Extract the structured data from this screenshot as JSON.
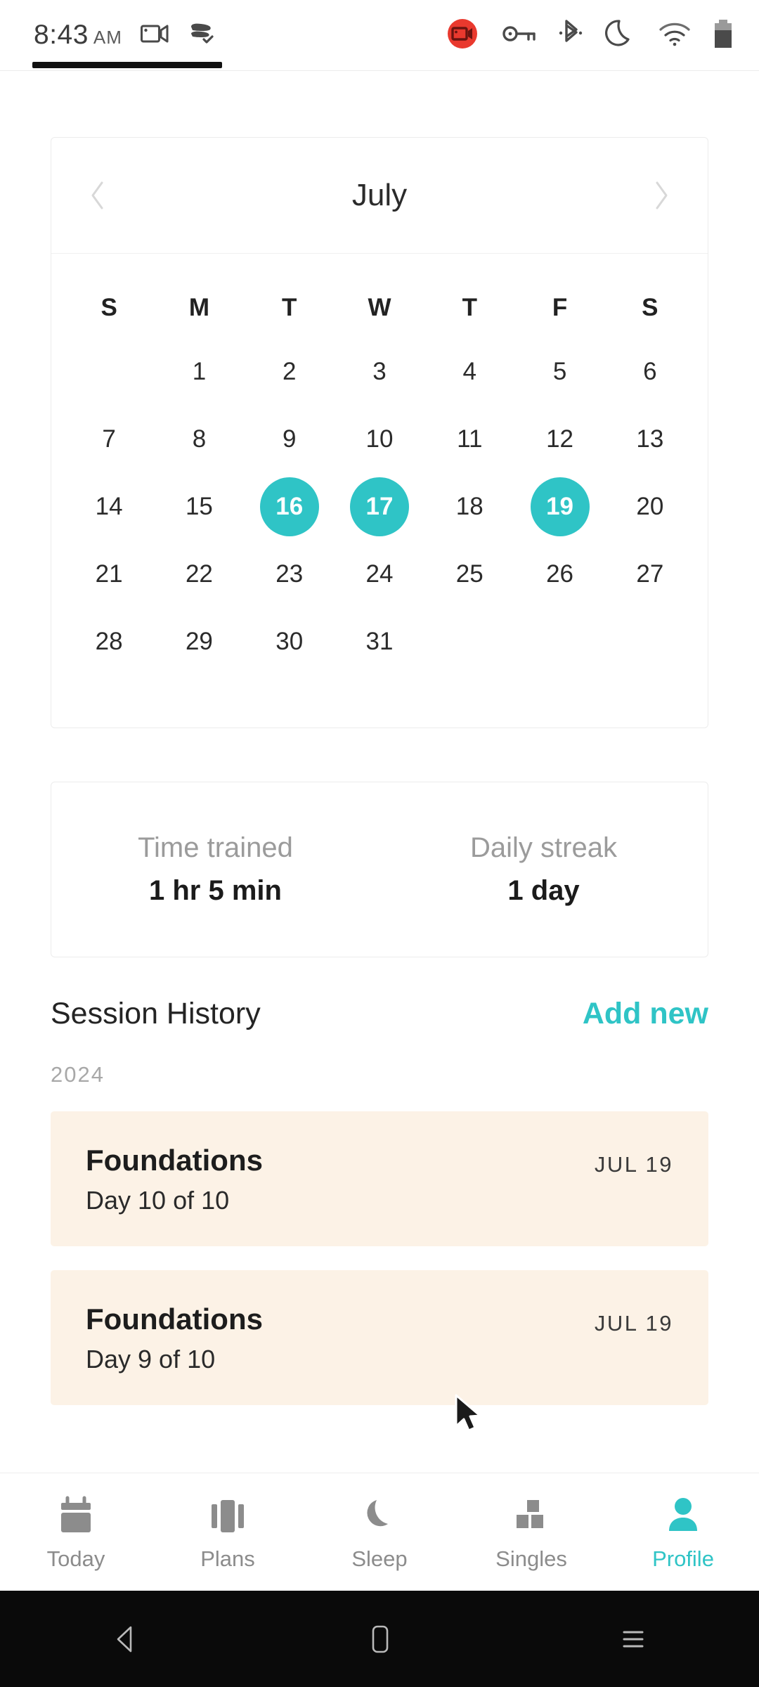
{
  "status_bar": {
    "time": "8:43",
    "ampm": "AM",
    "icons": [
      "screen-record-icon",
      "cast-icon",
      "recording-badge-icon",
      "key-icon",
      "bluetooth-icon",
      "do-not-disturb-moon-icon",
      "wifi-icon",
      "battery-icon"
    ]
  },
  "calendar": {
    "month": "July",
    "prev_label": "‹",
    "next_label": "›",
    "weekdays": [
      "S",
      "M",
      "T",
      "W",
      "T",
      "F",
      "S"
    ],
    "weeks": [
      [
        "",
        "1",
        "2",
        "3",
        "4",
        "5",
        "6"
      ],
      [
        "7",
        "8",
        "9",
        "10",
        "11",
        "12",
        "13"
      ],
      [
        "14",
        "15",
        "16",
        "17",
        "18",
        "19",
        "20"
      ],
      [
        "21",
        "22",
        "23",
        "24",
        "25",
        "26",
        "27"
      ],
      [
        "28",
        "29",
        "30",
        "31",
        "",
        "",
        ""
      ]
    ],
    "highlighted_days": [
      "16",
      "17",
      "19"
    ],
    "highlight_color": "#2fc4c6"
  },
  "stats": {
    "items": [
      {
        "label": "Time trained",
        "value": "1 hr 5 min"
      },
      {
        "label": "Daily streak",
        "value": "1 day"
      }
    ]
  },
  "session_history": {
    "title": "Session History",
    "add_new_label": "Add new",
    "year": "2024",
    "sessions": [
      {
        "name": "Foundations",
        "sub": "Day 10 of 10",
        "date": "JUL 19"
      },
      {
        "name": "Foundations",
        "sub": "Day 9 of 10",
        "date": "JUL 19"
      }
    ],
    "card_color": "#fcf2e6",
    "accent_color": "#2fc4c6"
  },
  "bottom_nav": {
    "items": [
      {
        "label": "Today",
        "icon": "calendar-icon",
        "active": false
      },
      {
        "label": "Plans",
        "icon": "cards-icon",
        "active": false
      },
      {
        "label": "Sleep",
        "icon": "moon-icon",
        "active": false
      },
      {
        "label": "Singles",
        "icon": "blocks-icon",
        "active": false
      },
      {
        "label": "Profile",
        "icon": "person-icon",
        "active": true
      }
    ],
    "active_color": "#2fc4c6",
    "inactive_color": "#8c8c8c"
  },
  "android_nav": {
    "back": "back-triangle-icon",
    "home": "home-square-icon",
    "recents": "recents-lines-icon"
  }
}
